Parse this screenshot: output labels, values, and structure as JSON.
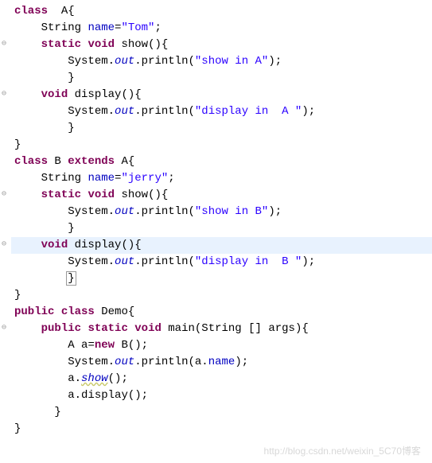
{
  "code": {
    "l1": {
      "kw1": "class",
      "sp1": "  ",
      "cls": "A",
      "br": "{"
    },
    "l2": {
      "ind": "    ",
      "type": "String",
      "sp": " ",
      "field": "name",
      "eq": "=",
      "str": "\"Tom\"",
      "semi": ";"
    },
    "l3": {
      "ind": "    ",
      "kw1": "static",
      "sp1": " ",
      "kw2": "void",
      "sp2": " ",
      "m": "show",
      "paren": "(){"
    },
    "l4": {
      "ind": "        ",
      "cls": "System",
      "dot1": ".",
      "out": "out",
      "dot2": ".",
      "m": "println",
      "op": "(",
      "str": "\"show in A\"",
      "cp": ");"
    },
    "l5": {
      "ind": "        ",
      "br": "}"
    },
    "l6": {
      "ind": "    ",
      "kw": "void",
      "sp": " ",
      "m": "display",
      "paren": "(){"
    },
    "l7": {
      "ind": "        ",
      "cls": "System",
      "dot1": ".",
      "out": "out",
      "dot2": ".",
      "m": "println",
      "op": "(",
      "str": "\"display in  A \"",
      "cp": ");"
    },
    "l8": {
      "ind": "        ",
      "br": "}"
    },
    "l9": {
      "ind": "",
      "br": "}"
    },
    "l10": {
      "kw1": "class",
      "sp1": " ",
      "cls": "B",
      "sp2": " ",
      "kw2": "extends",
      "sp3": " ",
      "sup": "A",
      "br": "{"
    },
    "l11": {
      "ind": "    ",
      "type": "String",
      "sp": " ",
      "field": "name",
      "eq": "=",
      "str": "\"jerry\"",
      "semi": ";"
    },
    "l12": {
      "ind": "    ",
      "kw1": "static",
      "sp1": " ",
      "kw2": "void",
      "sp2": " ",
      "m": "show",
      "paren": "(){"
    },
    "l13": {
      "ind": "        ",
      "cls": "System",
      "dot1": ".",
      "out": "out",
      "dot2": ".",
      "m": "println",
      "op": "(",
      "str": "\"show in B\"",
      "cp": ");"
    },
    "l14": {
      "ind": "        ",
      "br": "}"
    },
    "l15": {
      "ind": "    ",
      "kw": "void",
      "sp": " ",
      "m": "display",
      "paren": "(){"
    },
    "l16": {
      "ind": "        ",
      "cls": "System",
      "dot1": ".",
      "out": "out",
      "dot2": ".",
      "m": "println",
      "op": "(",
      "str": "\"display in  B \"",
      "cp": ");"
    },
    "l17": {
      "ind": "        ",
      "br": "}"
    },
    "l18": {
      "ind": "",
      "br": "}"
    },
    "l19": {
      "kw1": "public",
      "sp1": " ",
      "kw2": "class",
      "sp2": " ",
      "cls": "Demo",
      "br": "{"
    },
    "l20": {
      "ind": "    ",
      "kw1": "public",
      "sp1": " ",
      "kw2": "static",
      "sp2": " ",
      "kw3": "void",
      "sp3": " ",
      "m": "main",
      "op": "(",
      "type": "String",
      "arr": " [] ",
      "arg": "args",
      "cp": "){"
    },
    "l21": {
      "ind": "        ",
      "type": "A",
      "sp": " ",
      "var": "a",
      "eq": "=",
      "kw": "new",
      "sp2": " ",
      "cls": "B",
      "paren": "();"
    },
    "l22": {
      "ind": "        ",
      "cls": "System",
      "dot1": ".",
      "out": "out",
      "dot2": ".",
      "m": "println",
      "op": "(",
      "var": "a",
      "dot3": ".",
      "field": "name",
      "cp": ");"
    },
    "l23": {
      "ind": "        ",
      "var": "a",
      "dot": ".",
      "m": "show",
      "paren": "();"
    },
    "l24": {
      "ind": "        ",
      "var": "a",
      "dot": ".",
      "m": "display",
      "paren": "();"
    },
    "l25": {
      "ind": "      ",
      "br": "}"
    },
    "l26": {
      "ind": "",
      "br": "}"
    }
  },
  "gutter_marks": [
    "⊖",
    "⊖",
    "⊖",
    "⊖",
    "⊖",
    "⊖",
    "⊖"
  ],
  "watermark": "http://blog.csdn.net/weixin_5C70博客"
}
